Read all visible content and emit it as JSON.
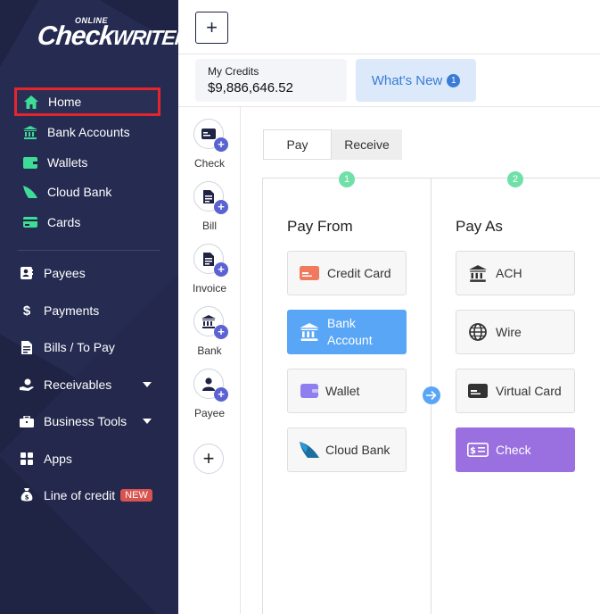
{
  "sidebar": {
    "logo_small": "ONLINE",
    "logo_main": "Check",
    "logo_sub": "WRITER",
    "items": [
      {
        "label": "Home"
      },
      {
        "label": "Bank Accounts"
      },
      {
        "label": "Wallets"
      },
      {
        "label": "Cloud Bank"
      },
      {
        "label": "Cards"
      },
      {
        "label": "Payees"
      },
      {
        "label": "Payments"
      },
      {
        "label": "Bills / To Pay"
      },
      {
        "label": "Receivables"
      },
      {
        "label": "Business Tools"
      },
      {
        "label": "Apps"
      },
      {
        "label": "Line of credit"
      }
    ],
    "new_badge": "NEW",
    "accent": "#3ddc97",
    "active_border": "#e3252e"
  },
  "header": {
    "add": "+",
    "credits_label": "My Credits",
    "credits_value": "$9,886,646.52",
    "whats_new": "What's New",
    "whats_new_count": "1"
  },
  "quick_create": [
    {
      "label": "Check"
    },
    {
      "label": "Bill"
    },
    {
      "label": "Invoice"
    },
    {
      "label": "Bank"
    },
    {
      "label": "Payee"
    }
  ],
  "quick_add": "+",
  "tabs": {
    "pay": "Pay",
    "receive": "Receive"
  },
  "steps": {
    "one": "1",
    "two": "2"
  },
  "pay_from": {
    "title": "Pay From",
    "options": [
      {
        "label": "Credit Card"
      },
      {
        "label_line1": "Bank",
        "label_line2": "Account"
      },
      {
        "label": "Wallet"
      },
      {
        "label": "Cloud Bank"
      }
    ]
  },
  "pay_as": {
    "title": "Pay As",
    "options": [
      {
        "label": "ACH"
      },
      {
        "label": "Wire"
      },
      {
        "label": "Virtual Card"
      },
      {
        "label": "Check"
      }
    ]
  }
}
